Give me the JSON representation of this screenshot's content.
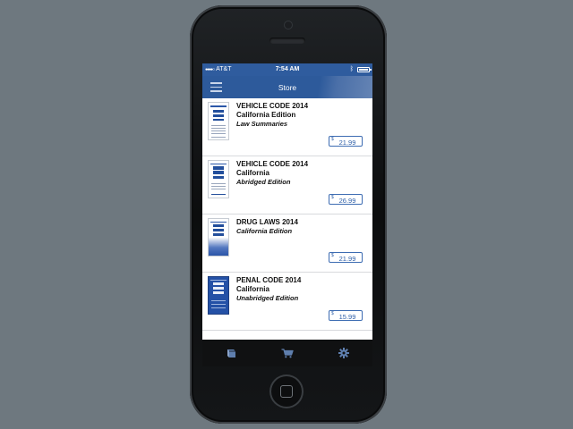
{
  "status_bar": {
    "carrier": "AT&T",
    "time": "7:54 AM"
  },
  "nav": {
    "title": "Store"
  },
  "products": [
    {
      "title": "VEHICLE CODE 2014",
      "subtitle": "California Edition",
      "edition": "Law Summaries",
      "currency": "$",
      "price": "21.99"
    },
    {
      "title": "VEHICLE CODE 2014",
      "subtitle": "California",
      "edition": "Abridged Edition",
      "currency": "$",
      "price": "26.99"
    },
    {
      "title": "DRUG LAWS 2014",
      "subtitle": "California Edition",
      "edition": "",
      "currency": "$",
      "price": "21.99"
    },
    {
      "title": "PENAL CODE 2014",
      "subtitle": "California",
      "edition": "Unabridged Edition",
      "currency": "$",
      "price": "15.99"
    }
  ],
  "tabbar": {
    "tabs": [
      {
        "icon": "book-icon"
      },
      {
        "icon": "cart-icon"
      },
      {
        "icon": "gear-icon"
      }
    ]
  },
  "colors": {
    "accent": "#2f5c9e",
    "price_text": "#2e5fa8",
    "tabbar": "#101112",
    "tab_icon": "#5f7fae",
    "background": "#6e787f"
  }
}
